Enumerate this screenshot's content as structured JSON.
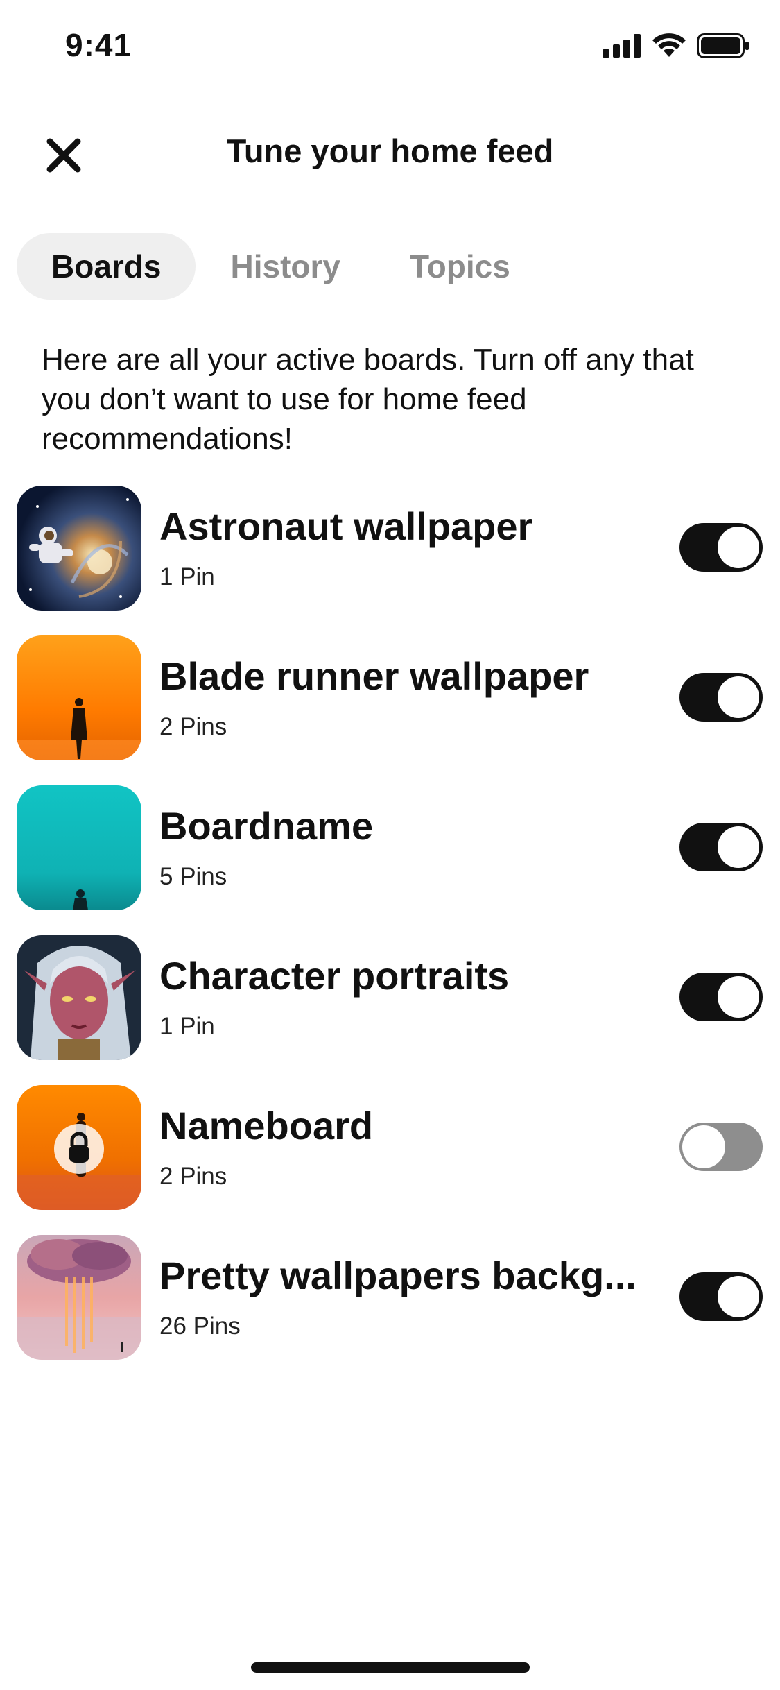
{
  "status_bar": {
    "time": "9:41"
  },
  "header": {
    "title": "Tune your home feed"
  },
  "tabs": [
    {
      "label": "Boards",
      "active": true
    },
    {
      "label": "History",
      "active": false
    },
    {
      "label": "Topics",
      "active": false
    }
  ],
  "description": "Here are all your active boards. Turn off any that you don’t want to use for home feed recommendations!",
  "boards": [
    {
      "name": "Astronaut wallpaper",
      "count": "1 Pin",
      "enabled": true
    },
    {
      "name": "Blade runner wallpaper",
      "count": "2 Pins",
      "enabled": true
    },
    {
      "name": "Boardname",
      "count": "5 Pins",
      "enabled": true
    },
    {
      "name": "Character portraits",
      "count": "1 Pin",
      "enabled": true
    },
    {
      "name": "Nameboard",
      "count": "2 Pins",
      "enabled": false,
      "secret": true
    },
    {
      "name": "Pretty wallpapers backg...",
      "count": "26 Pins",
      "enabled": true
    }
  ],
  "colors": {
    "toggle_on": "#111111",
    "toggle_off": "#8e8e8e",
    "tab_active_bg": "#efefef",
    "tab_inactive_text": "#8c8c8c"
  }
}
